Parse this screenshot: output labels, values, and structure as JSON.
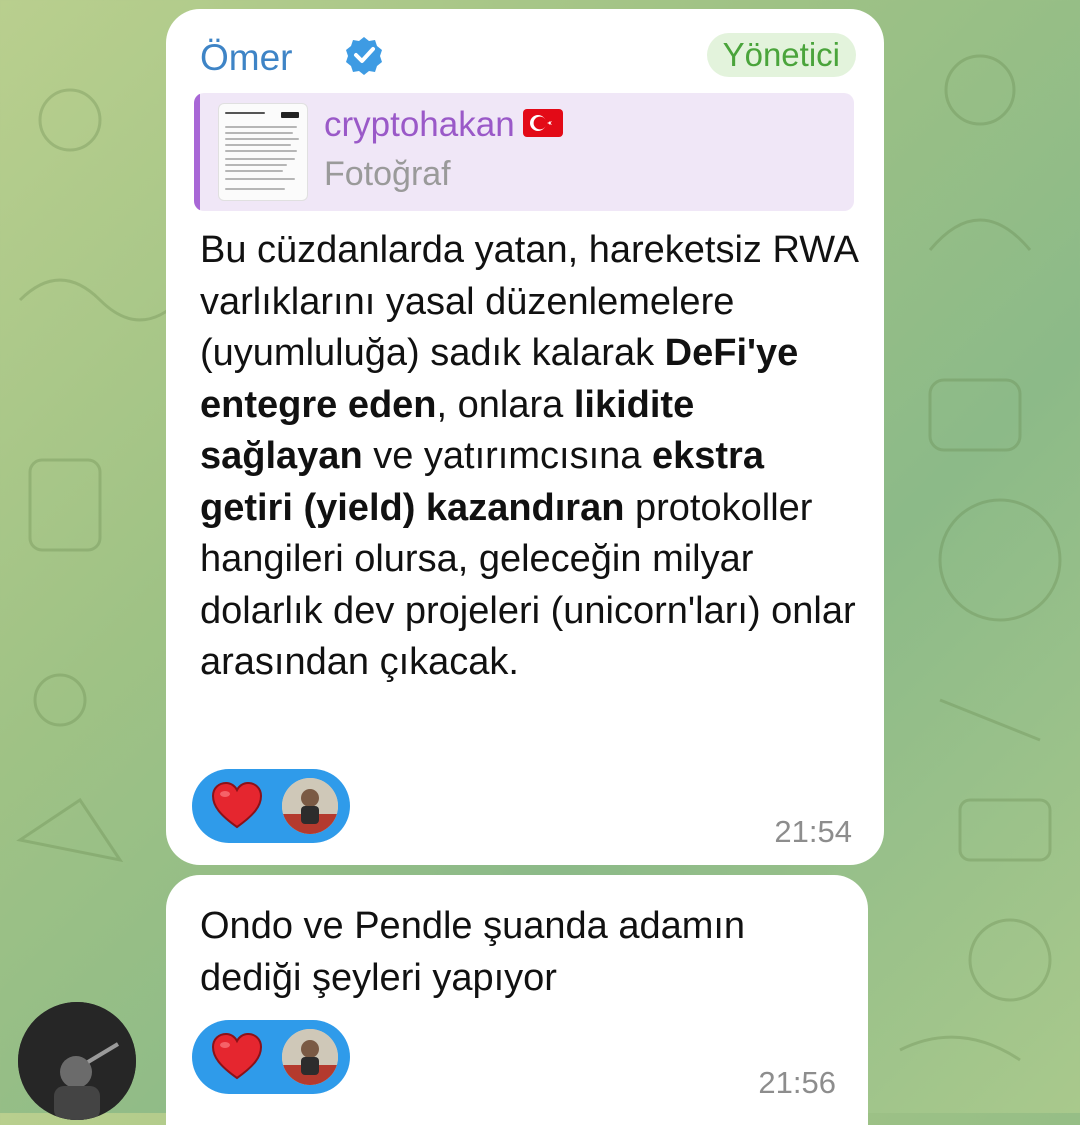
{
  "message1": {
    "sender": "Ömer",
    "role_badge": "Yönetici",
    "reply": {
      "author": "cryptohakan",
      "type": "Fotoğraf"
    },
    "text_segments": [
      {
        "text": "Bu cüzdanlarda yatan, hareketsiz RWA varlıklarını yasal düzenlemelere (uyumluluğa) sadık kalarak ",
        "bold": false
      },
      {
        "text": "DeFi'ye entegre eden",
        "bold": true
      },
      {
        "text": ", onlara ",
        "bold": false
      },
      {
        "text": "likidite sağlayan",
        "bold": true
      },
      {
        "text": " ve yatırımcısına ",
        "bold": false
      },
      {
        "text": "ekstra getiri (yield) kazandıran",
        "bold": true
      },
      {
        "text": " protokoller hangileri olursa, geleceğin milyar dolarlık dev projeleri (unicorn'ları) onlar arasından çıkacak.",
        "bold": false
      }
    ],
    "reaction_emoji": "heart",
    "time": "21:54"
  },
  "message2": {
    "text": "Ondo ve Pendle şuanda adamın dediği şeyleri yapıyor",
    "reaction_emoji": "heart",
    "time": "21:56"
  },
  "colors": {
    "sender_name": "#3e84c6",
    "badge_text": "#4aa43b",
    "badge_bg": "#e3f3dc",
    "reply_accent": "#a867d6",
    "reply_bg": "#f0e7f7",
    "reaction_bg": "#2f9bea",
    "heart": "#e5262f"
  }
}
